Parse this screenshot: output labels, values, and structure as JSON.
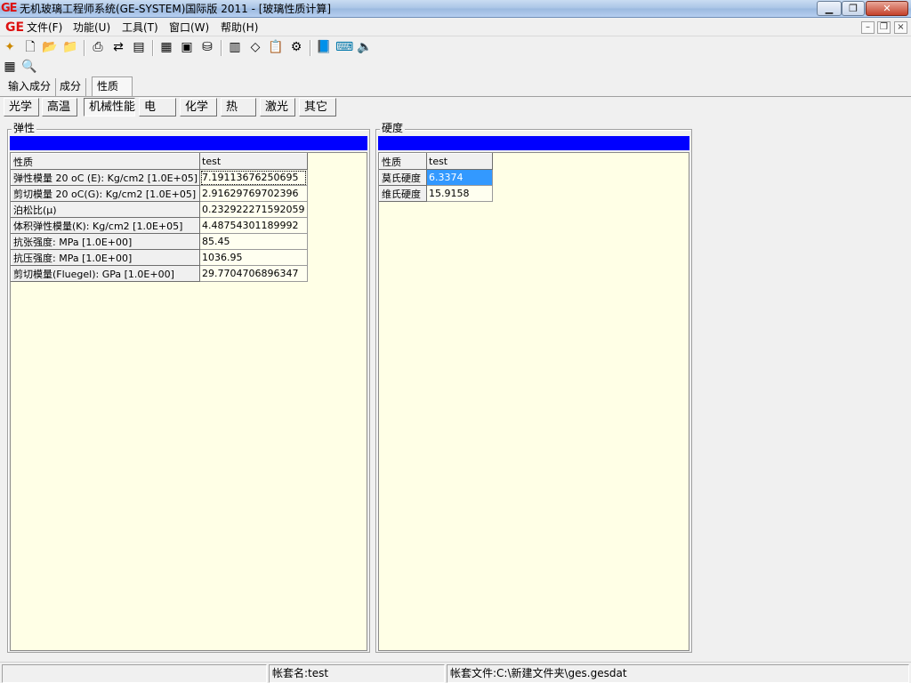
{
  "window": {
    "title": "无机玻璃工程师系统(GE-SYSTEM)国际版 2011 - [玻璃性质计算]",
    "logo": "GE"
  },
  "menu": {
    "logo": "GE",
    "items": [
      "文件(F)",
      "功能(U)",
      "工具(T)",
      "窗口(W)",
      "帮助(H)"
    ]
  },
  "main_tabs": [
    "输入成分",
    "成分",
    "性质"
  ],
  "sub_tabs": [
    "光学",
    "高温",
    "机械性能",
    "电",
    "化学",
    "热",
    "激光",
    "其它"
  ],
  "elasticity": {
    "caption": "弹性",
    "header": [
      "性质",
      "test"
    ],
    "rows": [
      [
        "弹性模量 20 oC (E): Kg/cm2 [1.0E+05]",
        "7.19113676250695"
      ],
      [
        "剪切模量 20 oC(G): Kg/cm2 [1.0E+05]",
        "2.91629769702396"
      ],
      [
        "泊松比(μ)",
        "0.232922271592059"
      ],
      [
        "体积弹性模量(K): Kg/cm2 [1.0E+05]",
        "4.48754301189992"
      ],
      [
        "抗张强度: MPa [1.0E+00]",
        "85.45"
      ],
      [
        "抗压强度: MPa [1.0E+00]",
        "1036.95"
      ],
      [
        "剪切模量(Fluegel): GPa [1.0E+00]",
        "29.7704706896347"
      ]
    ]
  },
  "hardness": {
    "caption": "硬度",
    "header": [
      "性质",
      "test"
    ],
    "rows": [
      [
        "莫氏硬度",
        "6.3374"
      ],
      [
        "维氏硬度",
        "15.9158"
      ]
    ]
  },
  "status": {
    "account": "帐套名:test",
    "file": "帐套文件:C:\\新建文件夹\\ges.gesdat"
  },
  "colors": {
    "title_bar": "#a9c4e6",
    "blue_bar": "#0000ff",
    "grid_bg": "#ffffe6",
    "selection": "#3399ff"
  }
}
